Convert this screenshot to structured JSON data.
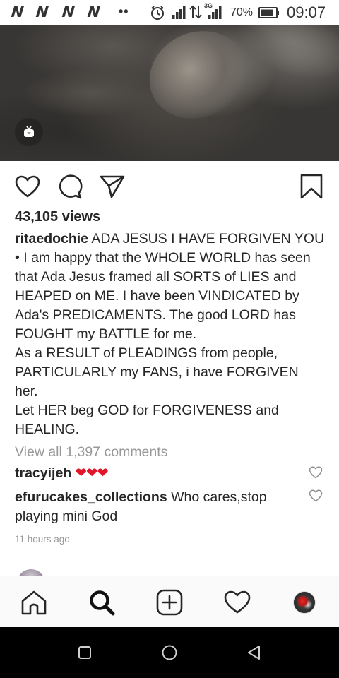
{
  "status_bar": {
    "notification_icons": [
      "N",
      "N",
      "N",
      "N"
    ],
    "network_type": "3G",
    "battery_percent": "70%",
    "time": "09:07"
  },
  "post": {
    "views": "43,105 views",
    "author": "ritaedochie",
    "caption_lines": [
      "ADA JESUS I HAVE FORGIVEN YOU",
      "• I am happy that the WHOLE WORLD has seen",
      "that Ada Jesus framed all SORTS of LIES and",
      "HEAPED on ME. I have been VINDICATED by",
      "Ada's PREDICAMENTS. The good LORD has",
      "FOUGHT my BATTLE for me.",
      "As a RESULT of PLEADINGS from people,",
      "PARTICULARLY my FANS, i have FORGIVEN",
      "her.",
      "Let HER beg GOD for FORGIVENESS and",
      "HEALING."
    ],
    "view_all_comments": "View all 1,397 comments",
    "comments": [
      {
        "username": "tracyijeh",
        "text": "❤❤❤"
      },
      {
        "username": "efurucakes_collections",
        "text_line1": "Who cares,stop",
        "text_line2": "playing mini God"
      }
    ],
    "timestamp": "11 hours ago"
  },
  "icons": {
    "igtv": "igtv-icon",
    "like": "heart-icon",
    "comment": "comment-bubble-icon",
    "share": "paper-plane-icon",
    "save": "bookmark-icon",
    "nav": [
      "home-icon",
      "search-icon",
      "add-post-icon",
      "activity-heart-icon",
      "profile-avatar"
    ],
    "android": [
      "recents-square-icon",
      "home-circle-icon",
      "back-triangle-icon"
    ]
  },
  "colors": {
    "text": "#262626",
    "muted": "#999999",
    "heart_emoji": "#e0162b",
    "nav_bg": "#fafafa",
    "android_nav_bg": "#000000"
  }
}
